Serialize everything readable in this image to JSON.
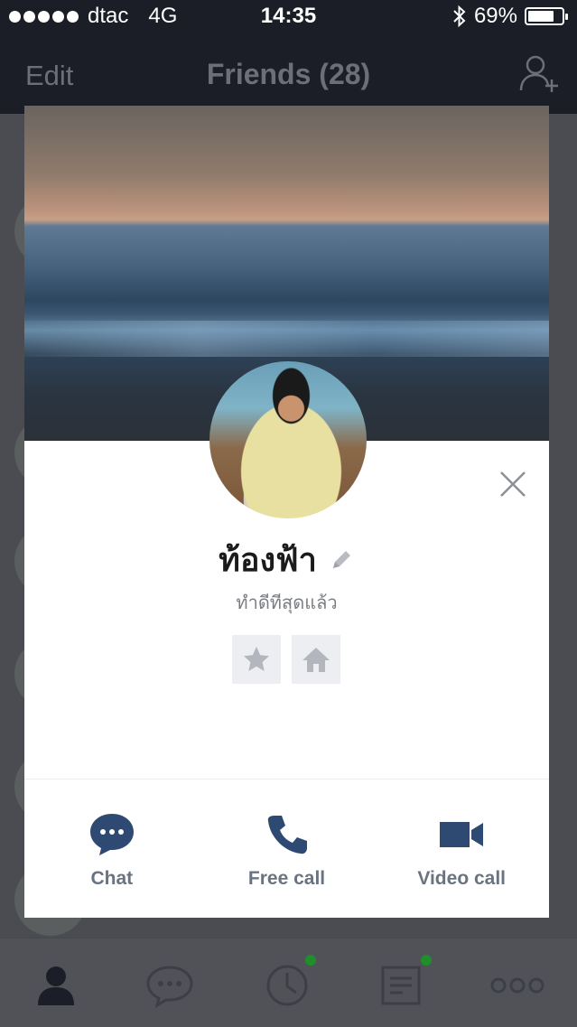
{
  "status_bar": {
    "carrier": "dtac",
    "network": "4G",
    "time": "14:35",
    "battery": "69%"
  },
  "nav": {
    "edit_label": "Edit",
    "title": "Friends (28)"
  },
  "profile": {
    "name": "ท้องฟ้า",
    "status_message": "ทำดีทีสุดแล้ว"
  },
  "actions": [
    {
      "label": "Chat",
      "icon": "chat-bubble-icon"
    },
    {
      "label": "Free call",
      "icon": "phone-icon"
    },
    {
      "label": "Video call",
      "icon": "video-camera-icon"
    }
  ],
  "colors": {
    "accent": "#2f4a72",
    "action_text": "#6a7380",
    "badge_green": "#1e8f2a"
  }
}
